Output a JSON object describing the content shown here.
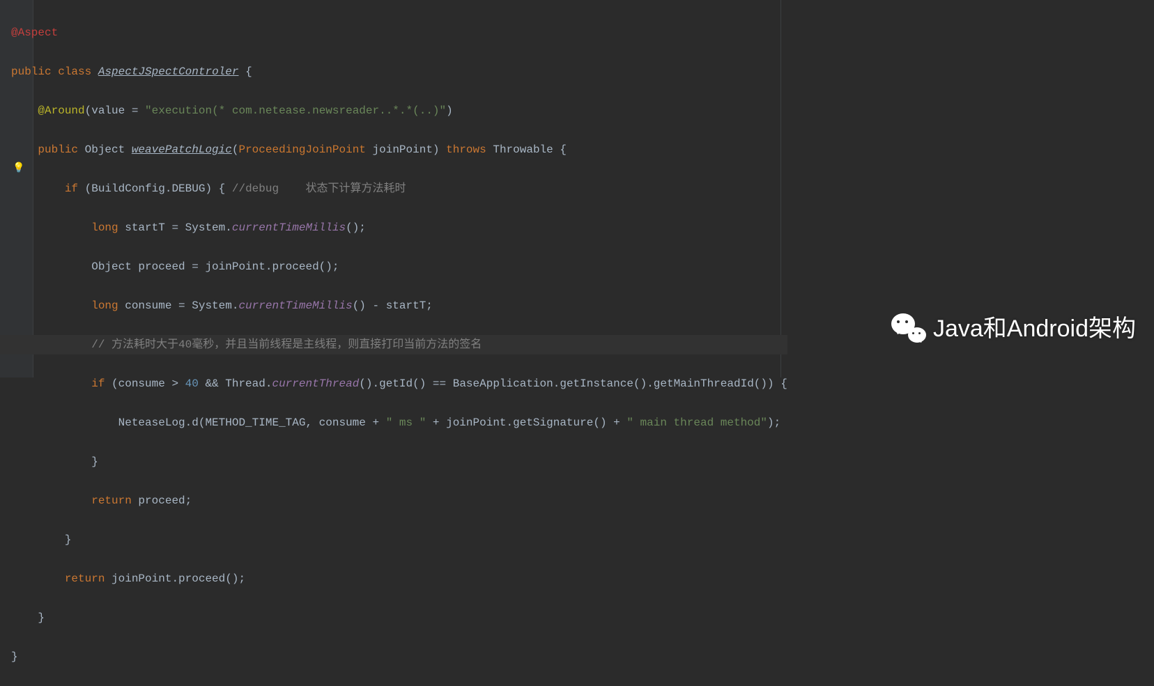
{
  "code": {
    "l1_ann": "@Aspect",
    "l2_kw1": "public",
    "l2_kw2": "class",
    "l2_cls": "AspectJSpectControler",
    "l2_brace": " {",
    "l3_ann": "@Around",
    "l3_paren": "(value = ",
    "l3_str": "\"execution(* com.netease.newsreader..*.*(..)\"",
    "l3_close": ")",
    "l4_kw1": "public",
    "l4_ret": " Object ",
    "l4_mth": "weavePatchLogic",
    "l4_paren": "(",
    "l4_ptype": "ProceedingJoinPoint",
    "l4_pname": " joinPoint) ",
    "l4_kw2": "throws",
    "l4_exc": " Throwable {",
    "l5_kw": "if",
    "l5_cond": " (BuildConfig.DEBUG) { ",
    "l5_cmt": "//debug    状态下计算方法耗时",
    "l6_kw": "long",
    "l6_var": " startT = System.",
    "l6_mth": "currentTimeMillis",
    "l6_rest": "();",
    "l7_txt": "Object proceed = joinPoint.proceed();",
    "l8_kw": "long",
    "l8_var": " consume = System.",
    "l8_mth": "currentTimeMillis",
    "l8_rest": "() - startT;",
    "l9_cmt": "// 方法耗时大于40毫秒，并且当前线程是主线程，则直接打印当前方法的签名",
    "l10_kw": "if",
    "l10_open": " (consume > ",
    "l10_num": "40",
    "l10_a": " && Thread.",
    "l10_mth": "currentThread",
    "l10_b": "().getId() == BaseApplication.getInstance().getMainThreadId()) {",
    "l11_a": "NeteaseLog.d(METHOD_TIME_TAG, consume + ",
    "l11_s1": "\" ms \"",
    "l11_b": " + joinPoint.getSignature() + ",
    "l11_s2": "\" main thread method\"",
    "l11_c": ");",
    "l12": "}",
    "l13_kw": "return",
    "l13_rest": " proceed;",
    "l14": "}",
    "l15_kw": "return",
    "l15_rest": " joinPoint.proceed();",
    "l16": "}",
    "l17": "}"
  },
  "watermark": "Java和Android架构"
}
